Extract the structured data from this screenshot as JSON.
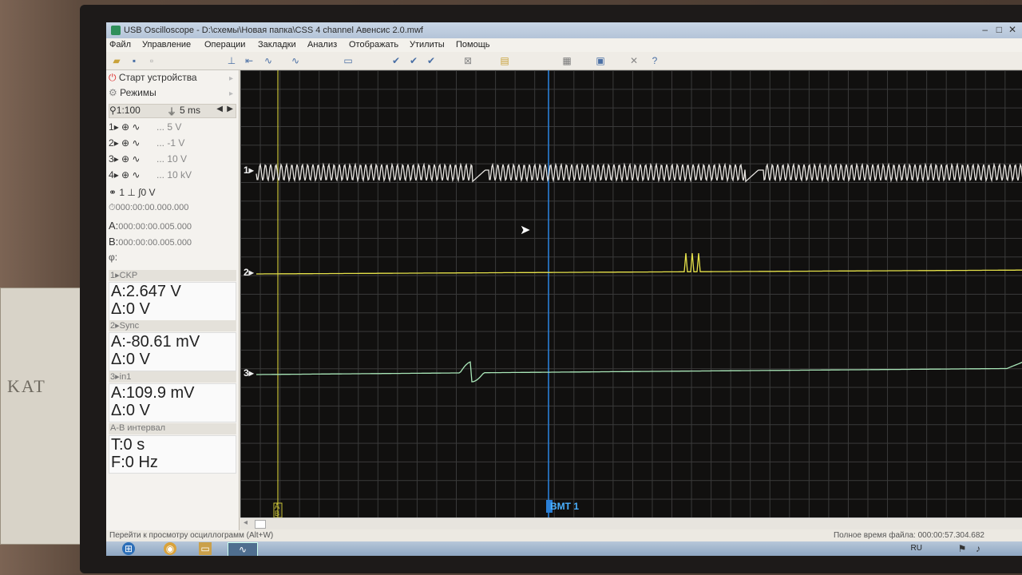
{
  "window": {
    "title": "USB Oscilloscope - D:\\схемы\\Новая папка\\CSS 4 channel Авенсис 2.0.mwf"
  },
  "menu": [
    "Файл",
    "Управление",
    "Операции",
    "Закладки",
    "Анализ",
    "Отображать",
    "Утилиты",
    "Помощь"
  ],
  "panel": {
    "start": "Старт устройства",
    "modes": "Режимы",
    "zoom": "1:100",
    "timebase": "5 ms",
    "channels": [
      {
        "num": "1",
        "scale": "... 5 V"
      },
      {
        "num": "2",
        "scale": "... -1 V"
      },
      {
        "num": "3",
        "scale": "... 10 V"
      },
      {
        "num": "4",
        "scale": "... 10 kV"
      }
    ],
    "trigger": "1 ⊥ ∫0 V",
    "time0": "000:00:00.000.000",
    "timeA": "000:00:00.005.000",
    "timeB": "000:00:00.005.000",
    "labelA": "A:",
    "labelB": "B:",
    "labelPhi": "φ:",
    "meas": [
      {
        "header": "1▸CKP",
        "a": "A:2.647 V",
        "d": "Δ:0 V"
      },
      {
        "header": "2▸Sync",
        "a": "A:-80.61 mV",
        "d": "Δ:0 V"
      },
      {
        "header": "3▸in1",
        "a": "A:109.9 mV",
        "d": "Δ:0 V"
      }
    ],
    "interval_header": "A-B интервал",
    "interval_t": "T:0 s",
    "interval_f": "F:0 Hz"
  },
  "scope": {
    "ch_labels": [
      "1▸",
      "2▸",
      "3▸"
    ],
    "cursor_label": "BMT 1",
    "marker_a": "A",
    "marker_b": "B",
    "colors": {
      "ch1": "#e9e6e2",
      "ch2": "#e6e24a",
      "ch3": "#a9e6b8",
      "cursor": "#2a7fd6",
      "marker": "#c9c23a"
    }
  },
  "status": {
    "hint": "Перейти к просмотру осциллограмм (Alt+W)",
    "file_time": "Полное время файла: 000:00:57.304.682"
  },
  "taskbar": {
    "lang": "RU"
  }
}
